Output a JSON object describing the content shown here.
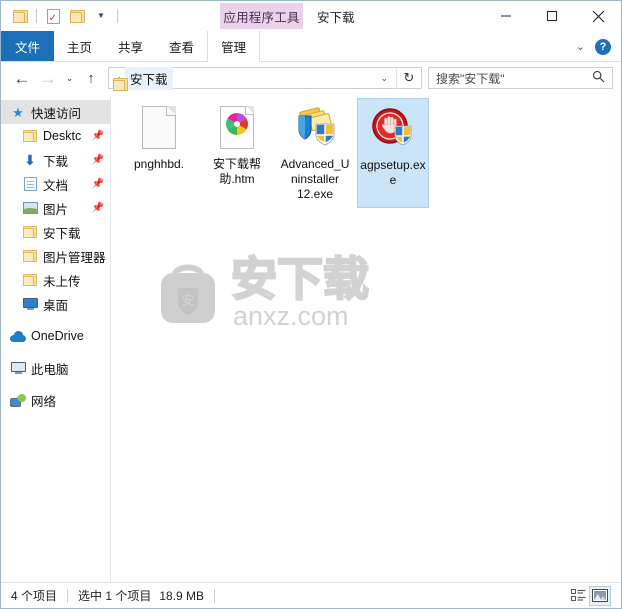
{
  "window": {
    "title": "安下载",
    "contextual_group": "应用程序工具",
    "controls": {
      "minimize": "minimize-icon",
      "maximize": "maximize-icon",
      "close": "close-icon"
    },
    "quick_access_toolbar": [
      {
        "name": "folder-icon",
        "label": ""
      },
      {
        "name": "properties-icon",
        "label": ""
      },
      {
        "name": "new-folder-icon",
        "label": ""
      },
      {
        "name": "customize-caret",
        "label": "▾"
      }
    ]
  },
  "ribbon": {
    "tabs": [
      {
        "label": "文件",
        "selected": true
      },
      {
        "label": "主页",
        "selected": false
      },
      {
        "label": "共享",
        "selected": false
      },
      {
        "label": "查看",
        "selected": false
      }
    ],
    "contextual_tab": {
      "label": "管理"
    },
    "collapse_caret": "⌄",
    "help_label": "?"
  },
  "address_bar": {
    "back": "←",
    "forward": "→",
    "recent_caret": "⌄",
    "up": "↑",
    "breadcrumb_separator": "›",
    "path": "安下载",
    "dropdown_caret": "⌄",
    "refresh": "↻"
  },
  "search": {
    "placeholder": "搜索\"安下载\"",
    "value": "搜索\"安下载\"",
    "icon": "search-icon"
  },
  "sidebar": {
    "items": [
      {
        "label": "快速访问",
        "icon": "star-icon",
        "selected": true,
        "indent": false,
        "pinned": false
      },
      {
        "label": "Desktc",
        "icon": "folder-icon",
        "selected": false,
        "indent": true,
        "pinned": true
      },
      {
        "label": "下载",
        "icon": "download-icon",
        "selected": false,
        "indent": true,
        "pinned": true
      },
      {
        "label": "文档",
        "icon": "documents-icon",
        "selected": false,
        "indent": true,
        "pinned": true
      },
      {
        "label": "图片",
        "icon": "pictures-icon",
        "selected": false,
        "indent": true,
        "pinned": true
      },
      {
        "label": "安下载",
        "icon": "folder-icon",
        "selected": false,
        "indent": true,
        "pinned": false
      },
      {
        "label": "图片管理器",
        "icon": "folder-icon",
        "selected": false,
        "indent": true,
        "pinned": false
      },
      {
        "label": "未上传",
        "icon": "folder-icon",
        "selected": false,
        "indent": true,
        "pinned": false
      },
      {
        "label": "桌面",
        "icon": "desktop-icon",
        "selected": false,
        "indent": true,
        "pinned": false
      },
      {
        "label": "OneDrive",
        "icon": "cloud-icon",
        "selected": false,
        "indent": false,
        "pinned": false
      },
      {
        "label": "此电脑",
        "icon": "this-pc-icon",
        "selected": false,
        "indent": false,
        "pinned": false
      },
      {
        "label": "网络",
        "icon": "network-icon",
        "selected": false,
        "indent": false,
        "pinned": false
      }
    ],
    "pin_glyph": "📌"
  },
  "files": [
    {
      "name": "pnghhbd.",
      "icon": "blank-document-icon",
      "selected": false
    },
    {
      "name": "安下载帮助.htm",
      "icon": "html-document-icon",
      "selected": false
    },
    {
      "name": "Advanced_Uninstaller 12.exe",
      "icon": "advanced-uninstaller-icon",
      "selected": false
    },
    {
      "name": "agpsetup.exe",
      "icon": "agpsetup-icon",
      "selected": true
    }
  ],
  "watermark": {
    "brand": "安下载",
    "shield_char": "安",
    "domain": "anxz.com"
  },
  "status_bar": {
    "item_count": "4 个项目",
    "selection": "选中 1 个项目",
    "size": "18.9 MB",
    "views": [
      {
        "name": "details-view-button",
        "active": false
      },
      {
        "name": "large-icons-view-button",
        "active": true
      }
    ]
  },
  "colors": {
    "accent": "#1d70b8",
    "contextual_tab": "#e8d3ea",
    "selection": "#cce4f7",
    "nav_selection": "#e3e3e3",
    "watermark": "#d4d4d4"
  }
}
